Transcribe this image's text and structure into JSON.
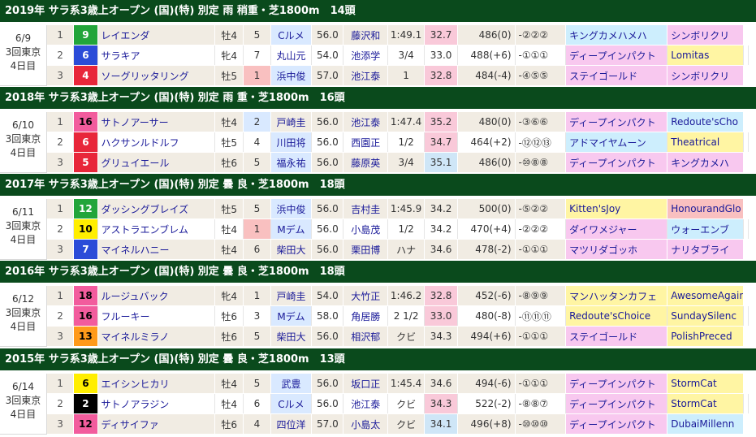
{
  "colors": {
    "header_bg": "#0a4a1c",
    "waku": {
      "1": "#ffffff",
      "2": "#000000",
      "3": "#e8263a",
      "4": "#e8263a",
      "5": "#2b4cd8",
      "6": "#2b4cd8",
      "7": "#ffee00",
      "8": "#ffee00",
      "9": "#22a53a",
      "10": "#ffee00",
      "12": "#22a53a",
      "13": "#ff9a1a",
      "16": "#f25c9d",
      "18": "#f25c9d"
    },
    "highlight_jockey": "#d9e9ff",
    "highlight_odds_pink": "#f9c9d9",
    "highlight_odds_blue": "#cfe6f7",
    "highlight_sire_pink": "#f8c8ef",
    "highlight_sire_yellow": "#fff5a3",
    "highlight_sire_blue": "#cdeefd",
    "highlight_red": "#f9c0c0"
  },
  "races": [
    {
      "header": "2019年 サラ系3歳上オープン (国)(特) 別定 雨 稍重・芝1800m　14頭",
      "date": "6/9",
      "meeting": "3回東京",
      "day": "4日目",
      "rows": [
        {
          "rank": "1",
          "waku": "9",
          "waku_bg": "#22a53a",
          "waku_fg": "#ffffff",
          "horse": "レイエンダ",
          "sex": "牡4",
          "no": "5",
          "no_bg": "",
          "jockey": "Cルメ",
          "jockey_bg": "#d9e9ff",
          "weight": "56.0",
          "trainer": "藤沢和",
          "time": "1:49.1",
          "odds": "32.7",
          "odds_bg": "#f9c9d9",
          "bw": "486(0)",
          "pass": "-②②②",
          "sire": "キングカメハメハ",
          "sire_bg": "#cdeefd",
          "dsire": "シンボリクリ",
          "dsire_bg": "#f8c8ef"
        },
        {
          "rank": "2",
          "waku": "6",
          "waku_bg": "#2b4cd8",
          "waku_fg": "#ffffff",
          "horse": "サラキア",
          "sex": "牝4",
          "no": "7",
          "no_bg": "",
          "jockey": "丸山元",
          "jockey_bg": "",
          "weight": "54.0",
          "trainer": "池添学",
          "time": "3/4",
          "odds": "33.0",
          "odds_bg": "",
          "bw": "488(+6)",
          "pass": "-①①①",
          "sire": "ディープインパクト",
          "sire_bg": "#f8c8ef",
          "dsire": "Lomitas",
          "dsire_bg": "#fff5a3"
        },
        {
          "rank": "3",
          "waku": "4",
          "waku_bg": "#e8263a",
          "waku_fg": "#ffffff",
          "horse": "ソーグリッタリング",
          "sex": "牡5",
          "no": "1",
          "no_bg": "#f9c0c0",
          "jockey": "浜中俊",
          "jockey_bg": "#d9e9ff",
          "weight": "57.0",
          "trainer": "池江泰",
          "time": "1",
          "odds": "32.8",
          "odds_bg": "#f9c9d9",
          "bw": "484(-4)",
          "pass": "-④⑤⑤",
          "sire": "ステイゴールド",
          "sire_bg": "#f8c8ef",
          "dsire": "シンボリクリ",
          "dsire_bg": "#f8c8ef"
        }
      ]
    },
    {
      "header": "2018年 サラ系3歳上オープン (国)(特) 別定 雨 重・芝1800m　16頭",
      "date": "6/10",
      "meeting": "3回東京",
      "day": "4日目",
      "rows": [
        {
          "rank": "1",
          "waku": "16",
          "waku_bg": "#f25c9d",
          "waku_fg": "#000000",
          "horse": "サトノアーサー",
          "sex": "牡4",
          "no": "2",
          "no_bg": "#d9e9ff",
          "jockey": "戸崎圭",
          "jockey_bg": "",
          "weight": "56.0",
          "trainer": "池江泰",
          "time": "1:47.4",
          "odds": "35.2",
          "odds_bg": "#f9c9d9",
          "bw": "480(0)",
          "pass": "-③⑥⑥",
          "sire": "ディープインパクト",
          "sire_bg": "#f8c8ef",
          "dsire": "Redoute'sCho",
          "dsire_bg": "#cdeefd"
        },
        {
          "rank": "2",
          "waku": "6",
          "waku_bg": "#e8263a",
          "waku_fg": "#ffffff",
          "horse": "ハクサンルドルフ",
          "sex": "牡5",
          "no": "4",
          "no_bg": "",
          "jockey": "川田将",
          "jockey_bg": "#d9e9ff",
          "weight": "56.0",
          "trainer": "西園正",
          "time": "1/2",
          "odds": "34.7",
          "odds_bg": "#f9c9d9",
          "bw": "464(+2)",
          "pass": "-⑫⑫⑬",
          "sire": "アドマイヤムーン",
          "sire_bg": "#cdeefd",
          "dsire": "Theatrical",
          "dsire_bg": "#fff5a3"
        },
        {
          "rank": "3",
          "waku": "5",
          "waku_bg": "#e8263a",
          "waku_fg": "#ffffff",
          "horse": "グリュイエール",
          "sex": "牡6",
          "no": "5",
          "no_bg": "",
          "jockey": "福永祐",
          "jockey_bg": "#d9e9ff",
          "weight": "56.0",
          "trainer": "藤原英",
          "time": "3/4",
          "odds": "35.1",
          "odds_bg": "#cfe6f7",
          "bw": "486(0)",
          "pass": "-⑩⑧⑧",
          "sire": "ディープインパクト",
          "sire_bg": "#f8c8ef",
          "dsire": "キングカメハ",
          "dsire_bg": "#f8c8ef"
        }
      ]
    },
    {
      "header": "2017年 サラ系3歳上オープン (国)(特) 別定 曇 良・芝1800m　18頭",
      "date": "6/11",
      "meeting": "3回東京",
      "day": "4日目",
      "rows": [
        {
          "rank": "1",
          "waku": "12",
          "waku_bg": "#22a53a",
          "waku_fg": "#ffffff",
          "horse": "ダッシングブレイズ",
          "sex": "牡5",
          "no": "5",
          "no_bg": "",
          "jockey": "浜中俊",
          "jockey_bg": "#d9e9ff",
          "weight": "56.0",
          "trainer": "吉村圭",
          "time": "1:45.9",
          "odds": "34.2",
          "odds_bg": "",
          "bw": "500(0)",
          "pass": "-⑤②②",
          "sire": "Kitten'sJoy",
          "sire_bg": "#fff5a3",
          "dsire": "HonourandGlo",
          "dsire_bg": "#f9c0c0"
        },
        {
          "rank": "2",
          "waku": "10",
          "waku_bg": "#ffee00",
          "waku_fg": "#000000",
          "horse": "アストラエンブレム",
          "sex": "牡4",
          "no": "1",
          "no_bg": "#f9c0c0",
          "jockey": "Mデム",
          "jockey_bg": "#d9e9ff",
          "weight": "56.0",
          "trainer": "小島茂",
          "time": "1/2",
          "odds": "34.2",
          "odds_bg": "",
          "bw": "470(+4)",
          "pass": "-②②②",
          "sire": "ダイワメジャー",
          "sire_bg": "#f8c8ef",
          "dsire": "ウォーエンブ",
          "dsire_bg": "#cdeefd"
        },
        {
          "rank": "3",
          "waku": "7",
          "waku_bg": "#2b4cd8",
          "waku_fg": "#ffffff",
          "horse": "マイネルハニー",
          "sex": "牡4",
          "no": "6",
          "no_bg": "",
          "jockey": "柴田大",
          "jockey_bg": "",
          "weight": "56.0",
          "trainer": "栗田博",
          "time": "ハナ",
          "odds": "34.6",
          "odds_bg": "",
          "bw": "478(-2)",
          "pass": "-①①①",
          "sire": "マツリダゴッホ",
          "sire_bg": "#f8c8ef",
          "dsire": "ナリタブライ",
          "dsire_bg": "#f8c8ef"
        }
      ]
    },
    {
      "header": "2016年 サラ系3歳上オープン (国)(特) 別定 曇 良・芝1800m　18頭",
      "date": "6/12",
      "meeting": "3回東京",
      "day": "4日目",
      "rows": [
        {
          "rank": "1",
          "waku": "18",
          "waku_bg": "#f25c9d",
          "waku_fg": "#000000",
          "horse": "ルージュバック",
          "sex": "牝4",
          "no": "1",
          "no_bg": "",
          "jockey": "戸崎圭",
          "jockey_bg": "",
          "weight": "54.0",
          "trainer": "大竹正",
          "time": "1:46.2",
          "odds": "32.8",
          "odds_bg": "#f9c9d9",
          "bw": "452(-6)",
          "pass": "-⑧⑨⑨",
          "sire": "マンハッタンカフェ",
          "sire_bg": "#fff5a3",
          "dsire": "AwesomeAgain",
          "dsire_bg": "#fff5a3"
        },
        {
          "rank": "2",
          "waku": "16",
          "waku_bg": "#f25c9d",
          "waku_fg": "#000000",
          "horse": "フルーキー",
          "sex": "牡6",
          "no": "3",
          "no_bg": "",
          "jockey": "Mデム",
          "jockey_bg": "#d9e9ff",
          "weight": "58.0",
          "trainer": "角居勝",
          "time": "2 1/2",
          "odds": "33.0",
          "odds_bg": "#f9c9d9",
          "bw": "480(-8)",
          "pass": "-⑪⑪⑪",
          "sire": "Redoute'sChoice",
          "sire_bg": "#fff5a3",
          "dsire": "SundaySilenc",
          "dsire_bg": "#fff5a3"
        },
        {
          "rank": "3",
          "waku": "13",
          "waku_bg": "#ff9a1a",
          "waku_fg": "#000000",
          "horse": "マイネルミラノ",
          "sex": "牡6",
          "no": "5",
          "no_bg": "",
          "jockey": "柴田大",
          "jockey_bg": "",
          "weight": "56.0",
          "trainer": "相沢郁",
          "time": "クビ",
          "odds": "34.3",
          "odds_bg": "",
          "bw": "494(+6)",
          "pass": "-①①①",
          "sire": "ステイゴールド",
          "sire_bg": "#f8c8ef",
          "dsire": "PolishPreced",
          "dsire_bg": "#fff5a3"
        }
      ]
    },
    {
      "header": "2015年 サラ系3歳上オープン (国)(特) 別定 曇 良・芝1800m　13頭",
      "date": "6/14",
      "meeting": "3回東京",
      "day": "4日目",
      "rows": [
        {
          "rank": "1",
          "waku": "6",
          "waku_bg": "#ffee00",
          "waku_fg": "#000000",
          "horse": "エイシンヒカリ",
          "sex": "牡4",
          "no": "5",
          "no_bg": "",
          "jockey": "武豊",
          "jockey_bg": "#d9e9ff",
          "weight": "56.0",
          "trainer": "坂口正",
          "time": "1:45.4",
          "odds": "34.6",
          "odds_bg": "",
          "bw": "494(-6)",
          "pass": "-①①①",
          "sire": "ディープインパクト",
          "sire_bg": "#f8c8ef",
          "dsire": "StormCat",
          "dsire_bg": "#fff5a3"
        },
        {
          "rank": "2",
          "waku": "2",
          "waku_bg": "#000000",
          "waku_fg": "#ffffff",
          "horse": "サトノアラジン",
          "sex": "牡4",
          "no": "6",
          "no_bg": "",
          "jockey": "Cルメ",
          "jockey_bg": "#d9e9ff",
          "weight": "56.0",
          "trainer": "池江泰",
          "time": "クビ",
          "odds": "34.3",
          "odds_bg": "#f9c9d9",
          "bw": "522(-2)",
          "pass": "-⑧⑧⑦",
          "sire": "ディープインパクト",
          "sire_bg": "#f8c8ef",
          "dsire": "StormCat",
          "dsire_bg": "#fff5a3"
        },
        {
          "rank": "3",
          "waku": "12",
          "waku_bg": "#f25c9d",
          "waku_fg": "#000000",
          "horse": "ディサイファ",
          "sex": "牡6",
          "no": "4",
          "no_bg": "",
          "jockey": "四位洋",
          "jockey_bg": "",
          "weight": "57.0",
          "trainer": "小島太",
          "time": "クビ",
          "odds": "34.1",
          "odds_bg": "#cfe6f7",
          "bw": "496(+8)",
          "pass": "-⑩⑩⑩",
          "sire": "ディープインパクト",
          "sire_bg": "#f8c8ef",
          "dsire": "DubaiMillenn",
          "dsire_bg": "#cdeefd"
        }
      ]
    }
  ]
}
